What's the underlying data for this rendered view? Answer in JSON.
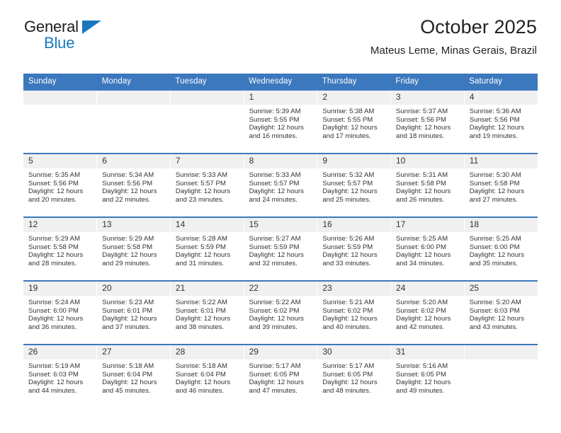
{
  "brand": {
    "name_top": "General",
    "name_bottom": "Blue",
    "accent_color": "#1878be",
    "triangle_icon": "triangle-icon"
  },
  "header": {
    "title": "October 2025",
    "subtitle": "Mateus Leme, Minas Gerais, Brazil"
  },
  "calendar": {
    "header_color": "#3b78bd",
    "weekdays": [
      "Sunday",
      "Monday",
      "Tuesday",
      "Wednesday",
      "Thursday",
      "Friday",
      "Saturday"
    ],
    "weeks": [
      [
        {
          "day": "",
          "sunrise": "",
          "sunset": "",
          "daylight1": "",
          "daylight2": ""
        },
        {
          "day": "",
          "sunrise": "",
          "sunset": "",
          "daylight1": "",
          "daylight2": ""
        },
        {
          "day": "",
          "sunrise": "",
          "sunset": "",
          "daylight1": "",
          "daylight2": ""
        },
        {
          "day": "1",
          "sunrise": "Sunrise: 5:39 AM",
          "sunset": "Sunset: 5:55 PM",
          "daylight1": "Daylight: 12 hours",
          "daylight2": "and 16 minutes."
        },
        {
          "day": "2",
          "sunrise": "Sunrise: 5:38 AM",
          "sunset": "Sunset: 5:55 PM",
          "daylight1": "Daylight: 12 hours",
          "daylight2": "and 17 minutes."
        },
        {
          "day": "3",
          "sunrise": "Sunrise: 5:37 AM",
          "sunset": "Sunset: 5:56 PM",
          "daylight1": "Daylight: 12 hours",
          "daylight2": "and 18 minutes."
        },
        {
          "day": "4",
          "sunrise": "Sunrise: 5:36 AM",
          "sunset": "Sunset: 5:56 PM",
          "daylight1": "Daylight: 12 hours",
          "daylight2": "and 19 minutes."
        }
      ],
      [
        {
          "day": "5",
          "sunrise": "Sunrise: 5:35 AM",
          "sunset": "Sunset: 5:56 PM",
          "daylight1": "Daylight: 12 hours",
          "daylight2": "and 20 minutes."
        },
        {
          "day": "6",
          "sunrise": "Sunrise: 5:34 AM",
          "sunset": "Sunset: 5:56 PM",
          "daylight1": "Daylight: 12 hours",
          "daylight2": "and 22 minutes."
        },
        {
          "day": "7",
          "sunrise": "Sunrise: 5:33 AM",
          "sunset": "Sunset: 5:57 PM",
          "daylight1": "Daylight: 12 hours",
          "daylight2": "and 23 minutes."
        },
        {
          "day": "8",
          "sunrise": "Sunrise: 5:33 AM",
          "sunset": "Sunset: 5:57 PM",
          "daylight1": "Daylight: 12 hours",
          "daylight2": "and 24 minutes."
        },
        {
          "day": "9",
          "sunrise": "Sunrise: 5:32 AM",
          "sunset": "Sunset: 5:57 PM",
          "daylight1": "Daylight: 12 hours",
          "daylight2": "and 25 minutes."
        },
        {
          "day": "10",
          "sunrise": "Sunrise: 5:31 AM",
          "sunset": "Sunset: 5:58 PM",
          "daylight1": "Daylight: 12 hours",
          "daylight2": "and 26 minutes."
        },
        {
          "day": "11",
          "sunrise": "Sunrise: 5:30 AM",
          "sunset": "Sunset: 5:58 PM",
          "daylight1": "Daylight: 12 hours",
          "daylight2": "and 27 minutes."
        }
      ],
      [
        {
          "day": "12",
          "sunrise": "Sunrise: 5:29 AM",
          "sunset": "Sunset: 5:58 PM",
          "daylight1": "Daylight: 12 hours",
          "daylight2": "and 28 minutes."
        },
        {
          "day": "13",
          "sunrise": "Sunrise: 5:29 AM",
          "sunset": "Sunset: 5:58 PM",
          "daylight1": "Daylight: 12 hours",
          "daylight2": "and 29 minutes."
        },
        {
          "day": "14",
          "sunrise": "Sunrise: 5:28 AM",
          "sunset": "Sunset: 5:59 PM",
          "daylight1": "Daylight: 12 hours",
          "daylight2": "and 31 minutes."
        },
        {
          "day": "15",
          "sunrise": "Sunrise: 5:27 AM",
          "sunset": "Sunset: 5:59 PM",
          "daylight1": "Daylight: 12 hours",
          "daylight2": "and 32 minutes."
        },
        {
          "day": "16",
          "sunrise": "Sunrise: 5:26 AM",
          "sunset": "Sunset: 5:59 PM",
          "daylight1": "Daylight: 12 hours",
          "daylight2": "and 33 minutes."
        },
        {
          "day": "17",
          "sunrise": "Sunrise: 5:25 AM",
          "sunset": "Sunset: 6:00 PM",
          "daylight1": "Daylight: 12 hours",
          "daylight2": "and 34 minutes."
        },
        {
          "day": "18",
          "sunrise": "Sunrise: 5:25 AM",
          "sunset": "Sunset: 6:00 PM",
          "daylight1": "Daylight: 12 hours",
          "daylight2": "and 35 minutes."
        }
      ],
      [
        {
          "day": "19",
          "sunrise": "Sunrise: 5:24 AM",
          "sunset": "Sunset: 6:00 PM",
          "daylight1": "Daylight: 12 hours",
          "daylight2": "and 36 minutes."
        },
        {
          "day": "20",
          "sunrise": "Sunrise: 5:23 AM",
          "sunset": "Sunset: 6:01 PM",
          "daylight1": "Daylight: 12 hours",
          "daylight2": "and 37 minutes."
        },
        {
          "day": "21",
          "sunrise": "Sunrise: 5:22 AM",
          "sunset": "Sunset: 6:01 PM",
          "daylight1": "Daylight: 12 hours",
          "daylight2": "and 38 minutes."
        },
        {
          "day": "22",
          "sunrise": "Sunrise: 5:22 AM",
          "sunset": "Sunset: 6:02 PM",
          "daylight1": "Daylight: 12 hours",
          "daylight2": "and 39 minutes."
        },
        {
          "day": "23",
          "sunrise": "Sunrise: 5:21 AM",
          "sunset": "Sunset: 6:02 PM",
          "daylight1": "Daylight: 12 hours",
          "daylight2": "and 40 minutes."
        },
        {
          "day": "24",
          "sunrise": "Sunrise: 5:20 AM",
          "sunset": "Sunset: 6:02 PM",
          "daylight1": "Daylight: 12 hours",
          "daylight2": "and 42 minutes."
        },
        {
          "day": "25",
          "sunrise": "Sunrise: 5:20 AM",
          "sunset": "Sunset: 6:03 PM",
          "daylight1": "Daylight: 12 hours",
          "daylight2": "and 43 minutes."
        }
      ],
      [
        {
          "day": "26",
          "sunrise": "Sunrise: 5:19 AM",
          "sunset": "Sunset: 6:03 PM",
          "daylight1": "Daylight: 12 hours",
          "daylight2": "and 44 minutes."
        },
        {
          "day": "27",
          "sunrise": "Sunrise: 5:18 AM",
          "sunset": "Sunset: 6:04 PM",
          "daylight1": "Daylight: 12 hours",
          "daylight2": "and 45 minutes."
        },
        {
          "day": "28",
          "sunrise": "Sunrise: 5:18 AM",
          "sunset": "Sunset: 6:04 PM",
          "daylight1": "Daylight: 12 hours",
          "daylight2": "and 46 minutes."
        },
        {
          "day": "29",
          "sunrise": "Sunrise: 5:17 AM",
          "sunset": "Sunset: 6:05 PM",
          "daylight1": "Daylight: 12 hours",
          "daylight2": "and 47 minutes."
        },
        {
          "day": "30",
          "sunrise": "Sunrise: 5:17 AM",
          "sunset": "Sunset: 6:05 PM",
          "daylight1": "Daylight: 12 hours",
          "daylight2": "and 48 minutes."
        },
        {
          "day": "31",
          "sunrise": "Sunrise: 5:16 AM",
          "sunset": "Sunset: 6:05 PM",
          "daylight1": "Daylight: 12 hours",
          "daylight2": "and 49 minutes."
        },
        {
          "day": "",
          "sunrise": "",
          "sunset": "",
          "daylight1": "",
          "daylight2": ""
        }
      ]
    ]
  }
}
